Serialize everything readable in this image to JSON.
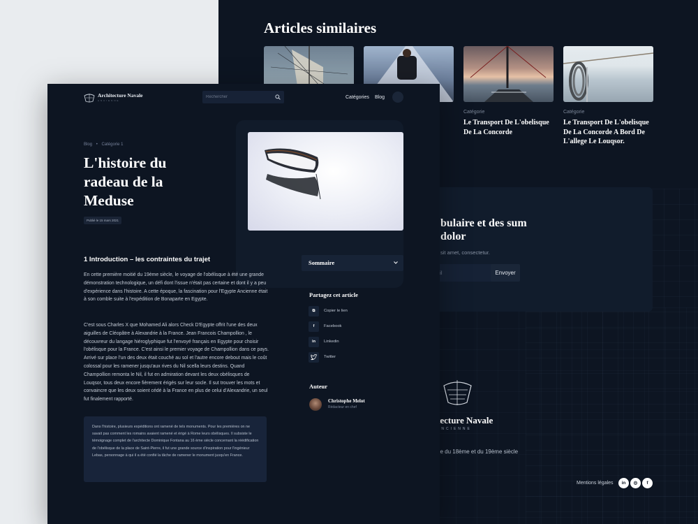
{
  "similar": {
    "title": "Articles similaires",
    "cards": [
      {
        "category": "",
        "title": "",
        "image": "sailing-ship-rigging-photo"
      },
      {
        "category": "",
        "title": "",
        "image": "boat-bow-deck-photo"
      },
      {
        "category": "Catégorie",
        "title": "Le Transport De L'obelisque De La Concorde",
        "image": "sunset-sailboat-photo"
      },
      {
        "category": "Catégorie",
        "title": "Le Transport De L'obelisque De La Concorde A Bord De L'allege Le Louqsor.",
        "image": "rope-on-railing-photo"
      }
    ]
  },
  "newsletter": {
    "title": "bulaire et des sum dolor",
    "subtitle": "sit amet, consectetur.",
    "input_placeholder": "ail",
    "button": "Envoyer"
  },
  "footer": {
    "brand": "tecture Navale",
    "brand_sub": "ANCIENNE",
    "description": "ne du 18ème et du 19ème siècle",
    "legal": "Mentions légales",
    "socials": [
      "linkedin-icon",
      "instagram-icon",
      "facebook-icon"
    ]
  },
  "header": {
    "brand": "Architecture Navale",
    "brand_sub": "ANCIENNE",
    "search_placeholder": "Rechercher",
    "nav": [
      "Catégories",
      "Blog"
    ]
  },
  "article": {
    "breadcrumb": [
      "Blog",
      "•",
      "Catégorie 1"
    ],
    "title": "L'histoire du radeau de la Meduse",
    "published": "Publié le 15 mars 2021",
    "section_title": "1 Introduction – les contraintes du trajet",
    "paragraph1": "En cette première moitié du 19ème siècle, le voyage de l'obélisque à été une grande démonstration technologique, un défi dont l'issue n'était pas certaine et dont il y a peu d'expérience dans l'histoire. A cette époque, la fascination pour l'Egypte Ancienne était à son comble suite à l'expédition de Bonaparte en Egypte.",
    "paragraph2": "C'est sous Charles X que Mohamed Ali alors Check D'Egypte offrit l'une des deux aiguilles de Cléopâtre à Alexandrie à la France. Jean Francois Champollion , le découvreur du langage hiéroglyphique fut l'envoyé français en Egypte pour choisir l'obélisque pour la France. C'est ainsi le premier voyage de Champollion dans ce pays. Arrivé sur place l'un des deux était couché au sol et l'autre encore debout mais le coût colossal pour les ramener jusqu'aux rives du Nil scella leurs destins. Quand Champollion remonta le Nil, il fut en admiration devant les deux obélisques de Louqsor, tous deux encore fièrement érigés sur leur socle. Il sut trouver les mots et convaincre que les deux soient cédé à la France en plus de celui d'Alexandrie, un seul fut finalement rapporté.",
    "quote": "Dans l'histoire, plusieurs expéditions ont ramené de tels monuments. Pour les premières on ne savait pas comment les romains avaient ramené et érigé à Rome leurs obélisques. Il subsiste le témoignage complet de l'architecte Dominique Fontana au 16 ème siècle concernant la réédification de l'obélisque de la place de Saint-Pierre, il fut une grande source d'inspiration pour l'ingénieur Lebas, personnage à qui il a été confié la tâche de ramener le monument jusqu'en France."
  },
  "sidebar": {
    "summary": "Sommaire",
    "share_title": "Partagez cet article",
    "share": [
      {
        "icon": "link-icon",
        "glyph": "⧉",
        "label": "Copier le lien"
      },
      {
        "icon": "facebook-icon",
        "glyph": "f",
        "label": "Facebook"
      },
      {
        "icon": "linkedin-icon",
        "glyph": "in",
        "label": "Linkedin"
      },
      {
        "icon": "twitter-icon",
        "glyph": "🐦",
        "label": "Twitter"
      }
    ],
    "author_title": "Auteur",
    "author_name": "Christophe Melot",
    "author_role": "Rédacteur en chef"
  }
}
